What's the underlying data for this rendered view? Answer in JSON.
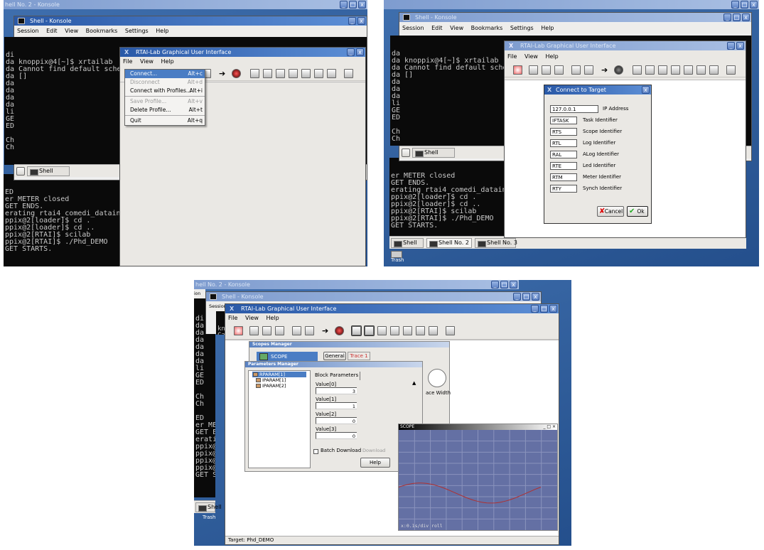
{
  "konsole_shell2_title": "hell No. 2 - Konsole",
  "konsole_shell_title": "Shell - Konsole",
  "konsole_menu": [
    "Session",
    "Edit",
    "View",
    "Bookmarks",
    "Settings",
    "Help"
  ],
  "rtai_title": "RTAI-Lab Graphical User Interface",
  "rtai_menu": [
    "File",
    "View",
    "Help"
  ],
  "panel_a": {
    "term_top": [
      "di",
      "da knoppix@4[~]$ xrtailab",
      "da Cannot find default sche",
      "da []",
      "da",
      "da",
      "da",
      "da",
      "li",
      "GE",
      "ED",
      "",
      "Ch",
      "Ch"
    ],
    "term_bottom": [
      "ED",
      "er METER closed",
      "GET ENDS.",
      "erating rtai4_comedi_datain",
      "ppix@2[loader]$ cd .",
      "ppix@2[loader]$ cd ..",
      "ppix@2[RTAI]$ scilab",
      "ppix@2[RTAI]$ ./Phd_DEMO",
      "GET STARTS."
    ],
    "tab_shell": "Shell",
    "file_menu": [
      {
        "label": "Connect...",
        "acc": "Alt+c",
        "state": "hl"
      },
      {
        "label": "Disconnect",
        "acc": "Alt+d",
        "state": "dis"
      },
      {
        "label": "Connect with Profiles...",
        "acc": "Alt+i",
        "state": ""
      },
      {
        "label": "",
        "acc": "",
        "state": "sep"
      },
      {
        "label": "Save Profile...",
        "acc": "Alt+v",
        "state": "dis"
      },
      {
        "label": "Delete Profile...",
        "acc": "Alt+t",
        "state": ""
      },
      {
        "label": "",
        "acc": "",
        "state": "sep"
      },
      {
        "label": "Quit",
        "acc": "Alt+q",
        "state": ""
      }
    ]
  },
  "panel_b": {
    "term_top": [
      "da",
      "da knoppix@4[~]$ xrtailab",
      "da Cannot find default sche",
      "da []",
      "da",
      "da",
      "da",
      "li",
      "GE",
      "ED",
      "",
      "Ch",
      "Ch"
    ],
    "term_bottom": [
      "er METER closed",
      "GET ENDS.",
      "erating rtai4_comedi_datain",
      "ppix@2[loader]$ cd .",
      "ppix@2[loader]$ cd ..",
      "ppix@2[RTAI]$ scilab",
      "ppix@2[RTAI]$ ./Phd_DEMO",
      "GET STARTS."
    ],
    "tab_shell": "Shell",
    "tabs_bottom": [
      "Shell",
      "Shell No. 2",
      "Shell No. 3"
    ],
    "trash": "Trash",
    "dialog_title": "Connect to Target",
    "fields": [
      {
        "value": "127.0.0.1",
        "label": "IP Address"
      },
      {
        "value": "IFTASK",
        "label": "Task Identifier"
      },
      {
        "value": "RTS",
        "label": "Scope Identifier"
      },
      {
        "value": "RTL",
        "label": "Log Identifier"
      },
      {
        "value": "RAL",
        "label": "ALog Identifier"
      },
      {
        "value": "RTE",
        "label": "Led Identifier"
      },
      {
        "value": "RTM",
        "label": "Meter Identifier"
      },
      {
        "value": "RTY",
        "label": "Synch Identifier"
      }
    ],
    "cancel": "Cancel",
    "ok": "Ok"
  },
  "panel_c": {
    "konsole_session": "Session",
    "term_left": [
      "di",
      "da",
      "da",
      "da",
      "da",
      "da",
      "da",
      "li",
      "GE",
      "ED",
      "",
      "Ch",
      "Ch",
      "",
      "ED",
      "er METE",
      "GET END",
      "erating",
      "ppix@2[",
      "ppix@2[",
      "ppix@2[",
      "ppix@2[",
      "GET STA"
    ],
    "term_top": [
      "knopp",
      "Canno",
      "[]"
    ],
    "tab_shell": "Shell",
    "trash": "Trash",
    "scopes_manager": "Scopes Manager",
    "scope_item": "SCOPE",
    "scope_tabs": [
      "General",
      "Trace 1"
    ],
    "params_manager": "Parameters Manager",
    "tree": [
      "RPARAM[1]",
      "IPARAM[1]",
      "IPARAM[2]"
    ],
    "block_params_tab": "Block Parameters",
    "values": [
      {
        "label": "Value[0]",
        "v": "3"
      },
      {
        "label": "Value[1]",
        "v": "1"
      },
      {
        "label": "Value[2]",
        "v": "0"
      },
      {
        "label": "Value[3]",
        "v": "0"
      }
    ],
    "batch_download": "Batch Download",
    "download": "Download",
    "help": "Help",
    "trace_width": "ace Width",
    "scope_window_title": "SCOPE",
    "scope_readout": "x:0.1s/div roll",
    "status": "Target: Phd_DEMO",
    "colors": {
      "grid_bg": "#6470a4",
      "trace": "#b03030"
    }
  }
}
